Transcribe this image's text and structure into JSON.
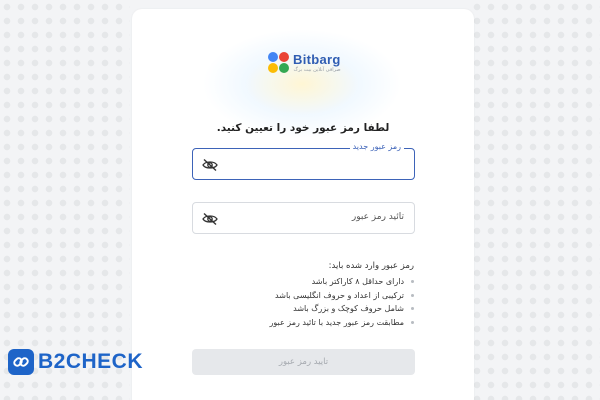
{
  "colors": {
    "accent": "#3d63b8",
    "brand": "#2f5db3",
    "watermark": "#1e64c8",
    "button_disabled_bg": "#e6e8eb"
  },
  "logo": {
    "brand_name": "Bitbarg",
    "tagline": "صرافی آنلاین بیت برگ",
    "icon": "four-colored-circles-logo"
  },
  "form": {
    "title": "لطفا رمز عبور خود را تعیین کنید.",
    "new_password": {
      "label": "رمز عبور جدید",
      "value": "",
      "icon": "eye-off-icon"
    },
    "confirm_password": {
      "placeholder": "تائید رمز عبور",
      "value": "",
      "icon": "eye-off-icon"
    },
    "requirements": {
      "title": "رمز عبور وارد شده باید:",
      "items": [
        "دارای حداقل ۸ کاراکتر باشد",
        "ترکیبی از اعداد و حروف انگلیسی باشد",
        "شامل حروف کوچک و بزرگ باشد",
        "مطابقت رمز عبور جدید با تائید رمز عبور"
      ]
    },
    "submit_label": "تایید رمز عبور"
  },
  "watermark": {
    "text": "B2CHECK",
    "icon": "link-icon"
  }
}
